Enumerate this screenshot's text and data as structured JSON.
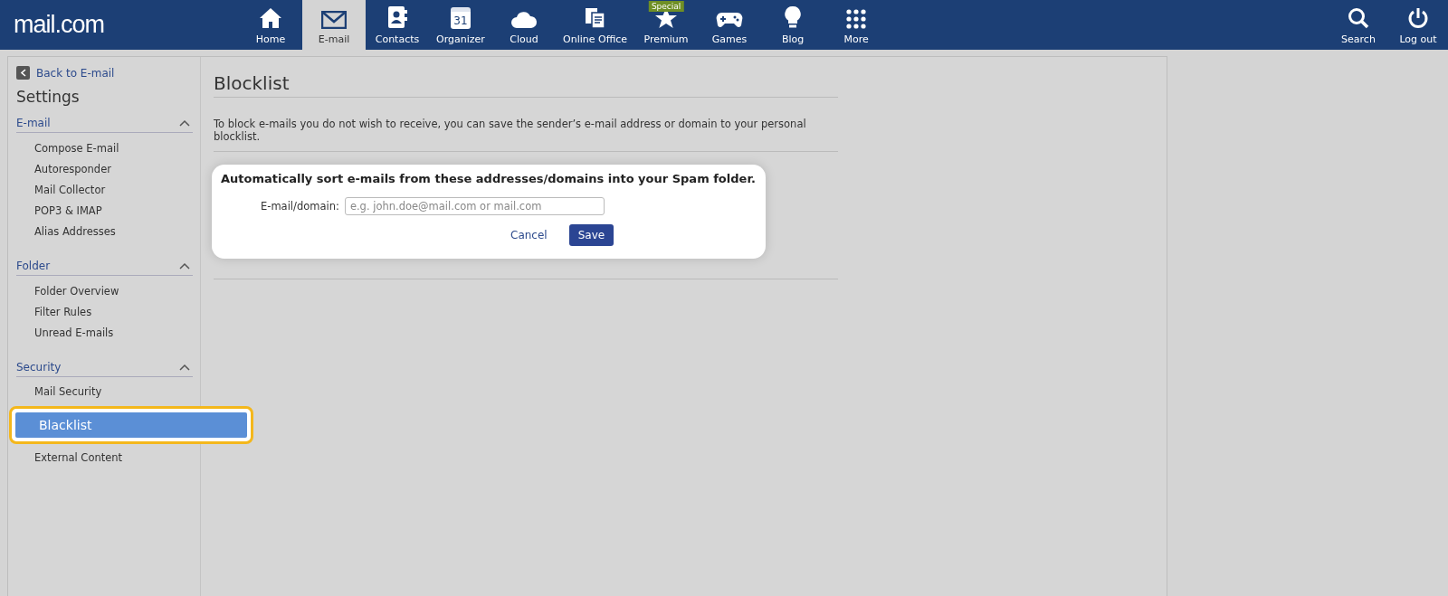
{
  "logo": "mail.com",
  "nav": [
    {
      "label": "Home",
      "selected": false
    },
    {
      "label": "E-mail",
      "selected": true
    },
    {
      "label": "Contacts",
      "selected": false
    },
    {
      "label": "Organizer",
      "selected": false,
      "icon_text": "31"
    },
    {
      "label": "Cloud",
      "selected": false
    },
    {
      "label": "Online Office",
      "selected": false
    },
    {
      "label": "Premium",
      "selected": false,
      "badge": "Special"
    },
    {
      "label": "Games",
      "selected": false
    },
    {
      "label": "Blog",
      "selected": false
    },
    {
      "label": "More",
      "selected": false
    }
  ],
  "nav_right": [
    {
      "label": "Search"
    },
    {
      "label": "Log out"
    }
  ],
  "sidebar": {
    "back_link": "Back to E-mail",
    "title": "Settings",
    "sections": [
      {
        "title": "E-mail",
        "expanded": true,
        "items": [
          {
            "label": "Compose E-mail",
            "selected": false
          },
          {
            "label": "Autoresponder",
            "selected": false
          },
          {
            "label": "Mail Collector",
            "selected": false
          },
          {
            "label": "POP3 & IMAP",
            "selected": false
          },
          {
            "label": "Alias Addresses",
            "selected": false
          }
        ]
      },
      {
        "title": "Folder",
        "expanded": true,
        "items": [
          {
            "label": "Folder Overview",
            "selected": false
          },
          {
            "label": "Filter Rules",
            "selected": false
          },
          {
            "label": "Unread E-mails",
            "selected": false
          }
        ]
      },
      {
        "title": "Security",
        "expanded": true,
        "items": [
          {
            "label": "Mail Security",
            "selected": false
          },
          {
            "label": "Blacklist",
            "selected": true
          },
          {
            "label": "External Content",
            "selected": false
          }
        ]
      }
    ]
  },
  "main": {
    "title": "Blocklist",
    "description": "To block e-mails you do not wish to receive, you can save the sender’s e-mail address or domain to your personal blocklist.",
    "dialog": {
      "heading": "Automatically sort e-mails from these addresses/domains into your Spam folder.",
      "field_label": "E-mail/domain:",
      "placeholder": "e.g. john.doe@mail.com or mail.com",
      "buttons": [
        {
          "label": "Cancel",
          "kind": "link"
        },
        {
          "label": "Save",
          "kind": "primary"
        }
      ]
    }
  }
}
